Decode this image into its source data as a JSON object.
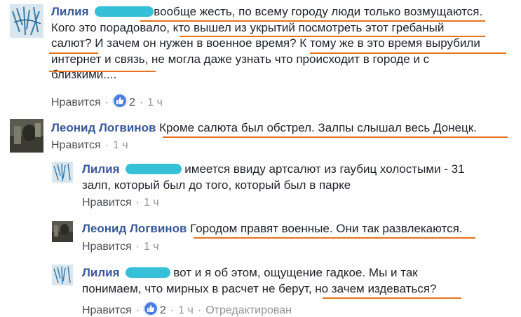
{
  "comments": [
    {
      "name": "Лилия",
      "text_line1": "вообще жесть, по всему городу люди только возмущаются.",
      "text_line2": "Кого это порадовало, кто вышел из укрытий посмотреть этот гребаный",
      "text_line3": "салют? И зачем он нужен в военное время? К тому же в это время вырубили",
      "text_line4": "интернет и связь, не могла даже узнать что происходит в городе и с",
      "text_line5": "близкими....",
      "like_label": "Нравится",
      "reaction_count": "2",
      "time": "1 ч"
    },
    {
      "name": "Леонид Логвинов",
      "text_line1": "Кроме салюта был обстрел. Залпы слышал весь Донецк.",
      "like_label": "Нравится",
      "time": "1 ч"
    },
    {
      "name": "Лилия",
      "text_line1": "имеется ввиду артсалют из гаубиц холостыми - 31",
      "text_line2": "залп, который был до того, который был в парке",
      "like_label": "Нравится",
      "time": "1 ч"
    },
    {
      "name": "Леонид Логвинов",
      "text_line1": "Городом правят военные. Они так развлекаются.",
      "like_label": "Нравится",
      "time": "1 ч"
    },
    {
      "name": "Лилия",
      "text_line1": "вот и я об этом, ощущение гадкое. Мы и так",
      "text_line2": "понимаем, что мирных в расчет не берут, но зачем издеваться?",
      "like_label": "Нравится",
      "reaction_count": "2",
      "time": "1 ч",
      "edited": "Отредактирован"
    }
  ],
  "colors": {
    "name": "#385898",
    "text": "#1d2129",
    "meta": "#90949c",
    "underline": "#e8731a",
    "redaction": "#1fb9d4",
    "like_reaction": "#4a7fe0"
  }
}
